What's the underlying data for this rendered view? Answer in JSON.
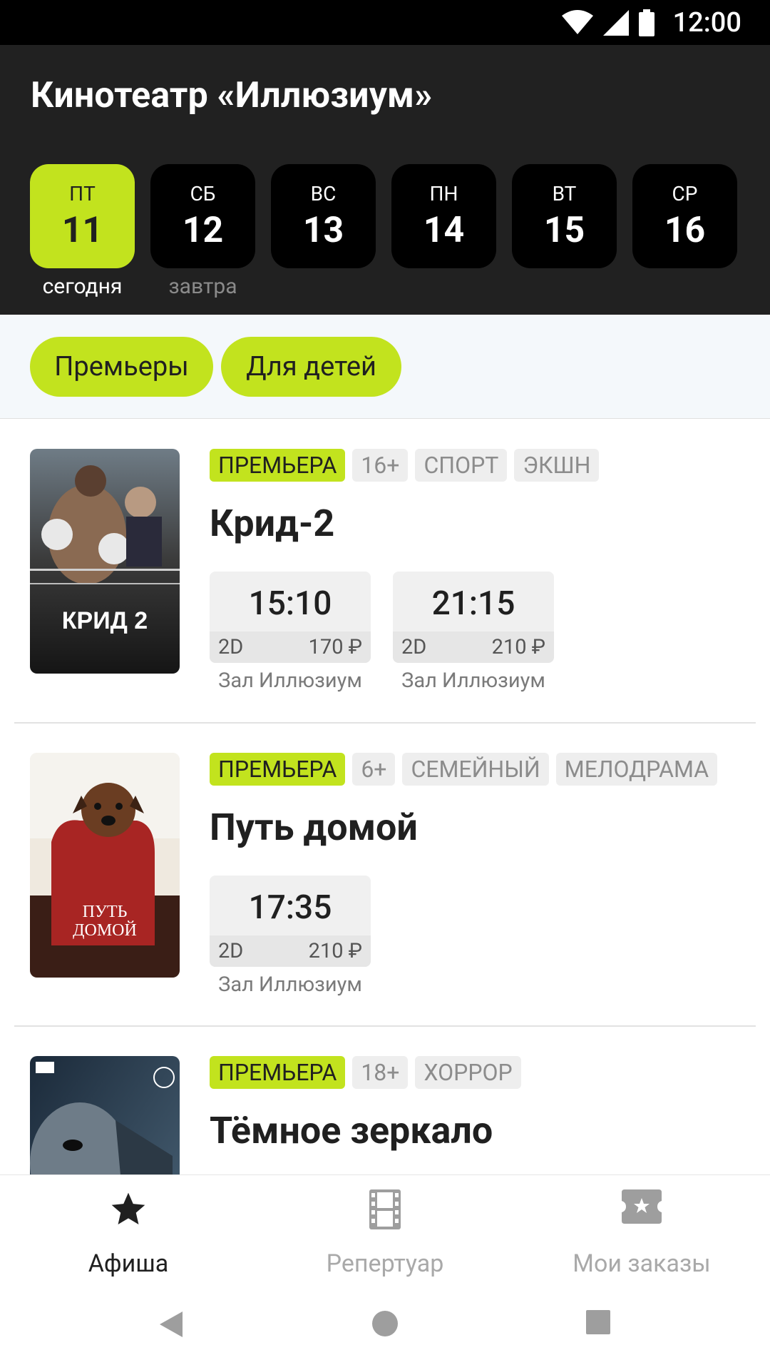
{
  "status_bar": {
    "time": "12:00"
  },
  "header": {
    "title": "Кинотеатр «Иллюзиум»"
  },
  "dates": [
    {
      "dow": "ПТ",
      "day": "11",
      "caption": "сегодня"
    },
    {
      "dow": "СБ",
      "day": "12",
      "caption": "завтра"
    },
    {
      "dow": "ВС",
      "day": "13",
      "caption": ""
    },
    {
      "dow": "ПН",
      "day": "14",
      "caption": ""
    },
    {
      "dow": "ВТ",
      "day": "15",
      "caption": ""
    },
    {
      "dow": "СР",
      "day": "16",
      "caption": ""
    }
  ],
  "filters": [
    "Премьеры",
    "Для детей"
  ],
  "movies": [
    {
      "tags": [
        "ПРЕМЬЕРА",
        "16+",
        "СПОРТ",
        "ЭКШН"
      ],
      "title": "Крид-2",
      "poster_text": "КРИД 2",
      "sessions": [
        {
          "time": "15:10",
          "format": "2D",
          "price": "170 ₽",
          "hall": "Зал Иллюзиум"
        },
        {
          "time": "21:15",
          "format": "2D",
          "price": "210 ₽",
          "hall": "Зал Иллюзиум"
        }
      ]
    },
    {
      "tags": [
        "ПРЕМЬЕРА",
        "6+",
        "СЕМЕЙНЫЙ",
        "МЕЛОДРАМА"
      ],
      "title": "Путь домой",
      "poster_text": "ПУТЬ ДОМОЙ",
      "sessions": [
        {
          "time": "17:35",
          "format": "2D",
          "price": "210 ₽",
          "hall": "Зал Иллюзиум"
        }
      ]
    },
    {
      "tags": [
        "ПРЕМЬЕРА",
        "18+",
        "ХОРРОР"
      ],
      "title": "Тёмное зеркало",
      "poster_text": "",
      "sessions": []
    }
  ],
  "bottom_nav": [
    {
      "label": "Афиша",
      "icon": "star-icon",
      "active": true
    },
    {
      "label": "Репертуар",
      "icon": "film-icon",
      "active": false
    },
    {
      "label": "Мои заказы",
      "icon": "ticket-icon",
      "active": false
    }
  ],
  "colors": {
    "accent": "#c2e31e",
    "header_bg": "#212121",
    "date_bg": "#000000"
  }
}
